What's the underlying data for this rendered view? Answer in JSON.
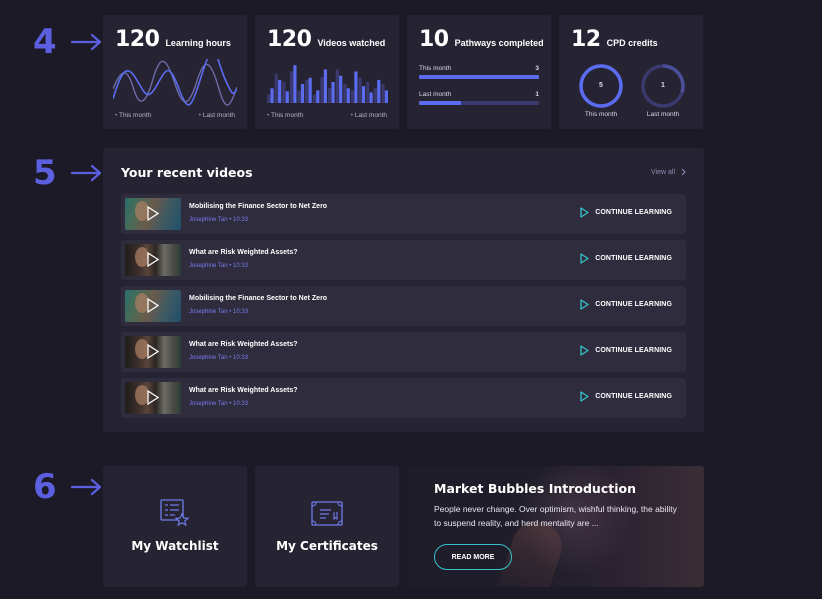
{
  "markers": [
    "4",
    "5",
    "6"
  ],
  "stats": {
    "learning_hours": {
      "value": "120",
      "label": "Learning hours",
      "legend_this": "This month",
      "legend_last": "Last month"
    },
    "videos_watched": {
      "value": "120",
      "label": "Videos watched",
      "legend_this": "This month",
      "legend_last": "Last month",
      "bars_this": [
        0.35,
        0.55,
        0.28,
        0.9,
        0.45,
        0.6,
        0.3,
        0.8,
        0.5,
        0.65,
        0.35,
        0.75,
        0.4,
        0.25,
        0.55,
        0.3
      ],
      "bars_last": [
        0.2,
        0.7,
        0.5,
        0.75,
        0.3,
        0.55,
        0.2,
        0.62,
        0.35,
        0.8,
        0.45,
        0.3,
        0.6,
        0.5,
        0.35,
        0.45
      ]
    },
    "pathways": {
      "value": "10",
      "label": "Pathways completed",
      "this_label": "This month",
      "this_value": "3",
      "this_fraction": 1.0,
      "last_label": "Last month",
      "last_value": "1",
      "last_fraction": 0.35
    },
    "cpd": {
      "value": "12",
      "label": "CPD credits",
      "this_value": "5",
      "this_label": "This month",
      "this_fraction": 1.0,
      "last_value": "1",
      "last_label": "Last month",
      "last_fraction": 0.3
    }
  },
  "recent": {
    "title": "Your recent videos",
    "view_all": "View all",
    "continue_label": "CONTINUE LEARNING",
    "videos": [
      {
        "title": "Mobilising the Finance Sector to Net Zero",
        "meta": "Josephine Tan • 10:33",
        "thumb": "a"
      },
      {
        "title": "What are Risk Weighted Assets?",
        "meta": "Josephine Tan • 10:33",
        "thumb": "b"
      },
      {
        "title": "Mobilising the Finance Sector to Net Zero",
        "meta": "Josephine Tan • 10:33",
        "thumb": "a"
      },
      {
        "title": "What are Risk Weighted Assets?",
        "meta": "Josephine Tan • 10:33",
        "thumb": "b"
      },
      {
        "title": "What are Risk Weighted Assets?",
        "meta": "Josephine Tan • 10:33",
        "thumb": "b"
      }
    ]
  },
  "tiles": {
    "watchlist": "My Watchlist",
    "certificates": "My Certificates"
  },
  "promo": {
    "title": "Market Bubbles Introduction",
    "text": "People never change. Over optimism, wishful thinking, the ability to suspend reality, and herd mentality are ...",
    "button": "READ MORE"
  },
  "colors": {
    "background": "#1c1a27",
    "card": "#262433",
    "accent": "#5b6cf0",
    "teal": "#36c3c8",
    "meta": "#7c7cf0"
  }
}
